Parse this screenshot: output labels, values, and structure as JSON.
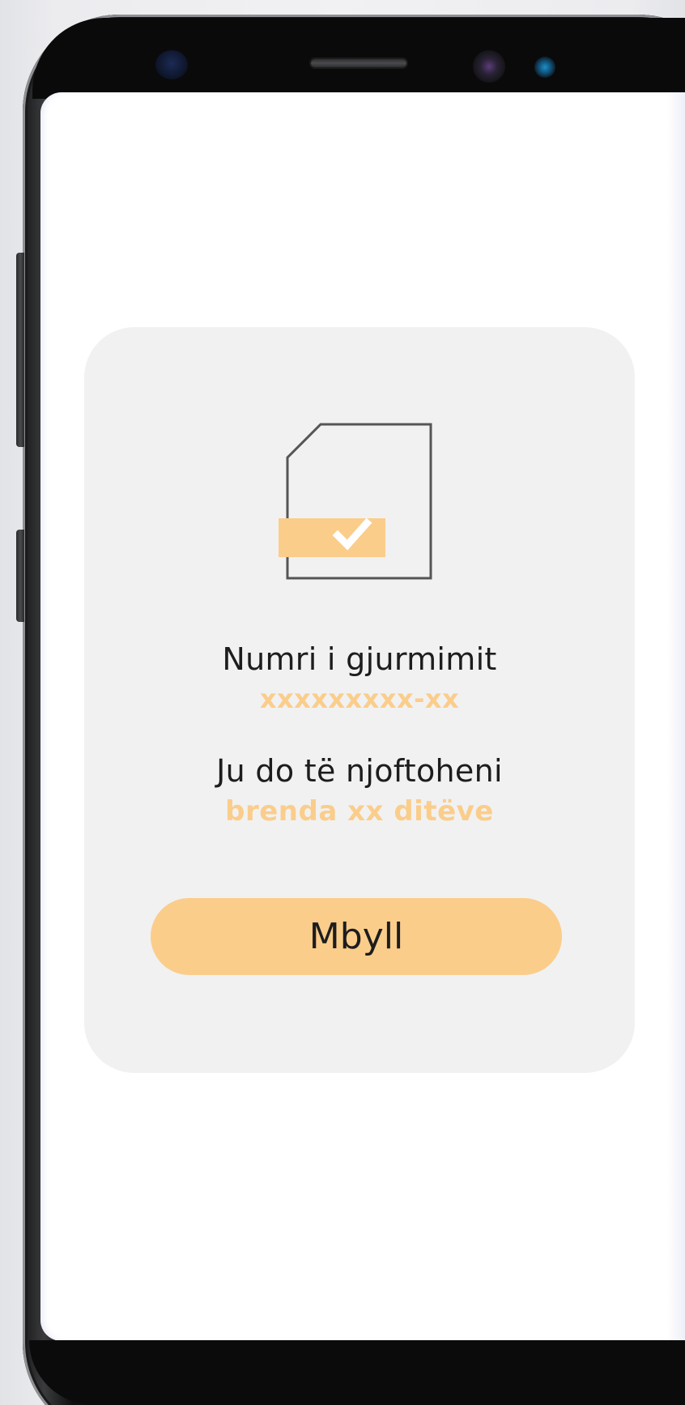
{
  "colors": {
    "accent": "#fbcd8b",
    "card_background": "#f1f1f1",
    "text": "#1d1d1d",
    "icon_outline": "#555555"
  },
  "dialog": {
    "icon": "document-check-icon",
    "tracking_label": "Numri i gjurmimit",
    "tracking_number": "xxxxxxxxx-xx",
    "notify_label": "Ju do të njoftoheni",
    "notify_period": "brenda xx ditëve",
    "close_button_label": "Mbyll"
  }
}
